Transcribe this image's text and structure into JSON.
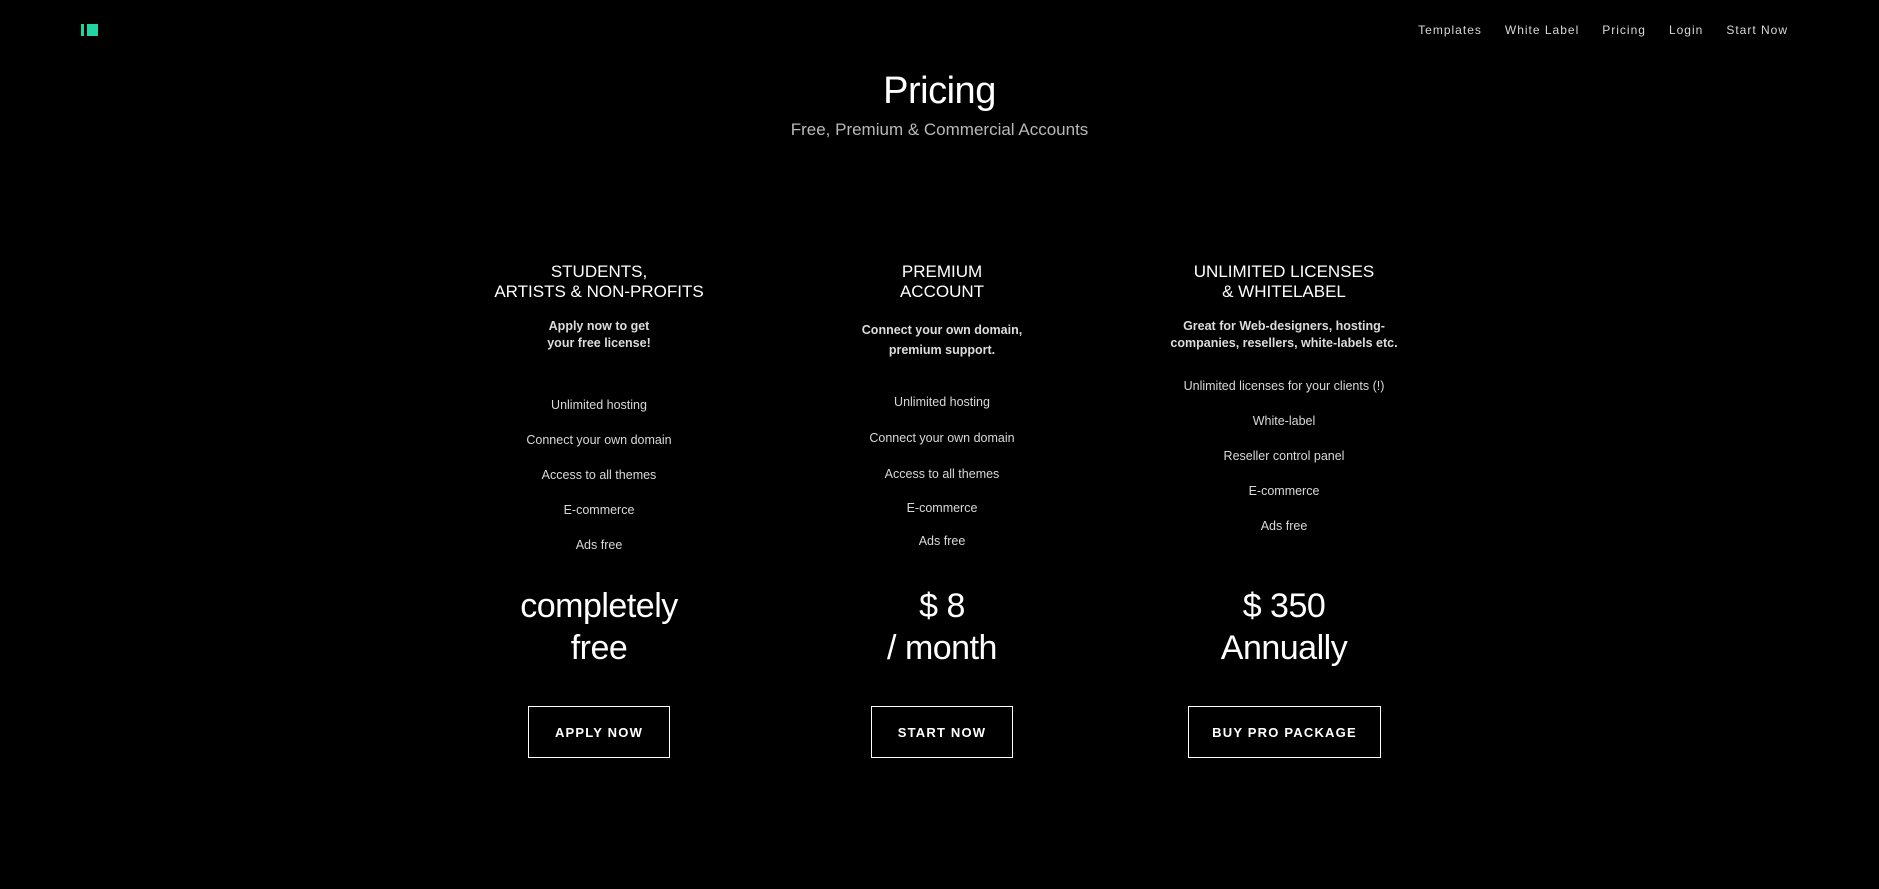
{
  "header": {
    "logo_icon": "brand-logo-icon",
    "accent_color": "#1fd6a3",
    "nav": [
      "Templates",
      "White Label",
      "Pricing",
      "Login",
      "Start Now"
    ]
  },
  "hero": {
    "title": "Pricing",
    "subtitle": "Free, Premium & Commercial Accounts"
  },
  "plans": [
    {
      "title": "STUDENTS,\nARTISTS & NON-PROFITS",
      "description": "Apply now to get\nyour free license!",
      "features": [
        "Unlimited hosting",
        "Connect your own domain",
        "Access to all themes",
        "E-commerce",
        "Ads free"
      ],
      "price_line1": "completely",
      "price_line2": "free",
      "button": "APPLY NOW"
    },
    {
      "title": "PREMIUM\nACCOUNT",
      "description": "Connect your own domain,\npremium support.",
      "features": [
        "Unlimited hosting",
        "Connect your own domain",
        "Access to all themes",
        "E-commerce",
        "Ads free"
      ],
      "price_line1": "$ 8",
      "price_line2": "/ month",
      "button": "START NOW"
    },
    {
      "title": "UNLIMITED LICENSES\n& WHITELABEL",
      "description": "Great for Web-designers, hosting-\ncompanies, resellers, white-labels etc.",
      "features": [
        "Unlimited licenses for your clients (!)",
        "White-label",
        "Reseller control panel",
        "E-commerce",
        "Ads free"
      ],
      "price_line1": "$ 350",
      "price_line2": "Annually",
      "button": "BUY PRO PACKAGE"
    }
  ]
}
